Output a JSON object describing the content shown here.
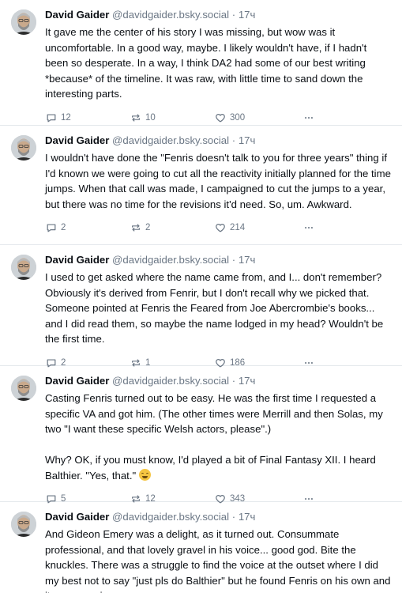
{
  "posts": [
    {
      "author": "David Gaider",
      "handle": "@davidgaider.bsky.social",
      "dot": "·",
      "age": "17ч",
      "text": "It gave me the center of his story I was missing, but wow was it uncomfortable. In a good way, maybe. I likely wouldn't have, if I hadn't been so desperate. In a way, I think DA2 had some of our best writing *because* of the timeline. It was raw, with little time to sand down the interesting parts.",
      "replies": "12",
      "reposts": "10",
      "likes": "300"
    },
    {
      "author": "David Gaider",
      "handle": "@davidgaider.bsky.social",
      "dot": "·",
      "age": "17ч",
      "text": "I wouldn't have done the \"Fenris doesn't talk to you for three years\" thing if I'd known we were going to cut all the reactivity initially planned for the time jumps. When that call was made, I campaigned to cut the jumps to a year, but there was no time for the revisions it'd need. So, um. Awkward.",
      "replies": "2",
      "reposts": "2",
      "likes": "214"
    },
    {
      "author": "David Gaider",
      "handle": "@davidgaider.bsky.social",
      "dot": "·",
      "age": "17ч",
      "text": "I used to get asked where the name came from, and I... don't remember? Obviously it's derived from Fenrir, but I don't recall why we picked that. Someone pointed at Fenris the Feared from Joe Abercrombie's books... and I did read them, so maybe the name lodged in my head? Wouldn't be the first time.",
      "replies": "2",
      "reposts": "1",
      "likes": "186"
    },
    {
      "author": "David Gaider",
      "handle": "@davidgaider.bsky.social",
      "dot": "·",
      "age": "17ч",
      "text": "Casting Fenris turned out to be easy. He was the first time I requested a specific VA and got him. (The other times were Merrill and then Solas, my two \"I want these specific Welsh actors, please\".)\n\nWhy? OK, if you must know, I'd played a bit of Final Fantasy XII. I heard Balthier. \"Yes, that.\"",
      "emoji": "grinning-sweat-emoji",
      "replies": "5",
      "reposts": "12",
      "likes": "343"
    },
    {
      "author": "David Gaider",
      "handle": "@davidgaider.bsky.social",
      "dot": "·",
      "age": "17ч",
      "text": "And Gideon Emery was a delight, as it turned out. Consummate professional, and that lovely gravel in his voice... good god. Bite the knuckles. There was a struggle to find the voice at the outset where I did my best not to say \"just pls do Balthier\" but he found Fenris on his own and it was amazing."
    }
  ],
  "icons": {
    "reply": "reply-icon",
    "repost": "repost-icon",
    "like": "like-icon",
    "more": "more-icon",
    "avatar": "avatar-photo"
  },
  "colors": {
    "text": "#0b0f14",
    "muted": "#6b7785",
    "divider": "#e4e8ec"
  }
}
